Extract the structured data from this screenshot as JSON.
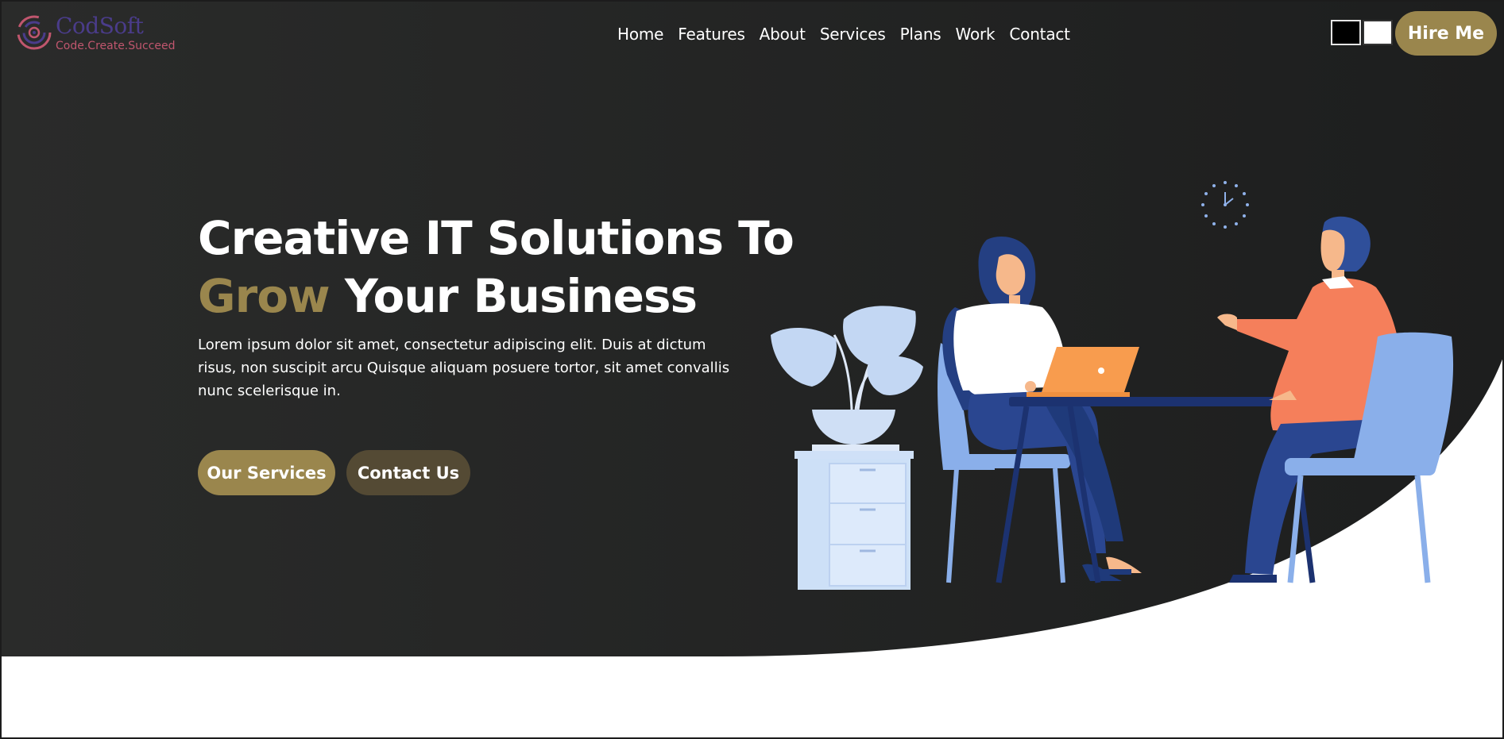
{
  "brand": {
    "name": "CodSoft",
    "tagline": "Code.Create.Succeed"
  },
  "nav": {
    "items": [
      "Home",
      "Features",
      "About",
      "Services",
      "Plans",
      "Work",
      "Contact"
    ]
  },
  "header": {
    "hire_label": "Hire Me",
    "theme_swatches": [
      "black",
      "white"
    ]
  },
  "hero": {
    "title_line1": "Creative IT Solutions To",
    "title_accent": "Grow",
    "title_line2_rest": " Your Business",
    "paragraph": "Lorem ipsum dolor sit amet, consectetur adipiscing elit. Duis at dictum risus, non suscipit arcu Quisque aliquam posuere tortor, sit amet convallis nunc scelerisque in.",
    "primary_button": "Our Services",
    "secondary_button": "Contact Us"
  },
  "colors": {
    "accent": "#9a864d",
    "secondary_button": "#544a34",
    "hero_bg": "#232424",
    "text": "#ffffff"
  },
  "icons": [
    "codsoft-logo-icon",
    "clock-icon"
  ]
}
